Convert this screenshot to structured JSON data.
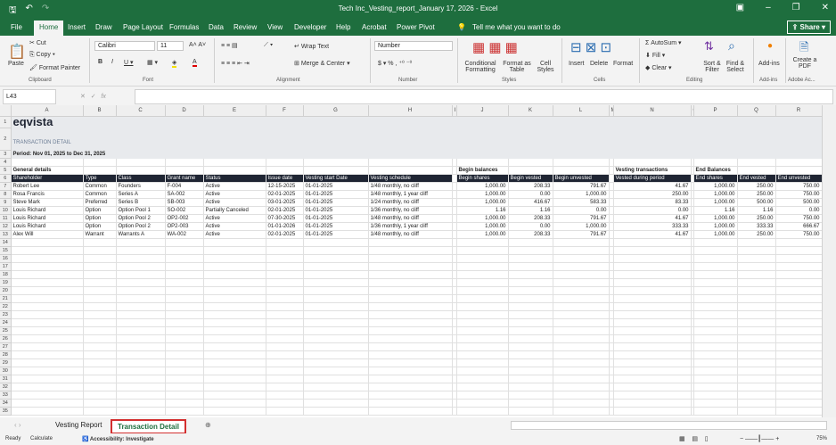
{
  "window": {
    "title": "Tech Inc_Vesting_report_January 17, 2026  -  Excel"
  },
  "ribbon_tabs": [
    "File",
    "Home",
    "Insert",
    "Draw",
    "Page Layout",
    "Formulas",
    "Data",
    "Review",
    "View",
    "Developer",
    "Help",
    "Acrobat",
    "Power Pivot"
  ],
  "tell_me": "Tell me what you want to do",
  "share": "Share",
  "clipboard": {
    "paste": "Paste",
    "cut": "Cut",
    "copy": "Copy",
    "format_painter": "Format Painter",
    "group": "Clipboard"
  },
  "font": {
    "name": "Calibri",
    "size": "11",
    "group": "Font"
  },
  "alignment": {
    "wrap": "Wrap Text",
    "merge": "Merge & Center",
    "group": "Alignment"
  },
  "number": {
    "format": "Number",
    "group": "Number"
  },
  "styles": {
    "conditional": "Conditional Formatting",
    "table": "Format as Table",
    "cell": "Cell Styles",
    "group": "Styles"
  },
  "cells": {
    "insert": "Insert",
    "delete": "Delete",
    "format": "Format",
    "group": "Cells"
  },
  "editing": {
    "autosum": "AutoSum",
    "fill": "Fill",
    "clear": "Clear",
    "sort": "Sort & Filter",
    "find": "Find & Select",
    "group": "Editing"
  },
  "addins": {
    "label": "Add-ins",
    "group": "Add-ins"
  },
  "adobe": {
    "label": "Create a PDF",
    "group": "Adobe Ac..."
  },
  "formula_bar": {
    "name_box": "L43",
    "fx": "fx",
    "value": ""
  },
  "columns": [
    "A",
    "B",
    "C",
    "D",
    "E",
    "F",
    "G",
    "H",
    "I",
    "J",
    "K",
    "L",
    "M",
    "N",
    "O",
    "P",
    "Q",
    "R"
  ],
  "sheet": {
    "logo": "eqvista",
    "subtitle": "TRANSACTION DETAIL",
    "period": "Period: Nov 01, 2025 to Dec 31, 2025",
    "sections": {
      "general": "General details",
      "begin": "Begin balances",
      "vesting": "Vesting transactions",
      "end": "End Balances"
    },
    "headers": [
      "Shareholder",
      "Type",
      "Class",
      "Grant name",
      "Status",
      "Issue date",
      "Vesting start Date",
      "Vesting schedule",
      "Begin shares",
      "Begin vested",
      "Begin unvested",
      "Vested during period",
      "End shares",
      "End vested",
      "End unvested"
    ],
    "rows": [
      [
        "Robert Lee",
        "Common",
        "Founders",
        "F-004",
        "Active",
        "12-15-2025",
        "01-01-2025",
        "1/48 monthly, no cliff",
        "1,000.00",
        "208.33",
        "791.67",
        "41.67",
        "1,000.00",
        "250.00",
        "750.00"
      ],
      [
        "Rosa Francis",
        "Common",
        "Series A",
        "SA-002",
        "Active",
        "02-01-2025",
        "01-01-2025",
        "1/48 monthly, 1 year cliff",
        "1,000.00",
        "0.00",
        "1,000.00",
        "250.00",
        "1,000.00",
        "250.00",
        "750.00"
      ],
      [
        "Steve Mark",
        "Preferred",
        "Series B",
        "SB-003",
        "Active",
        "03-01-2025",
        "01-01-2025",
        "1/24 monthly, no cliff",
        "1,000.00",
        "416.67",
        "583.33",
        "83.33",
        "1,000.00",
        "500.00",
        "500.00"
      ],
      [
        "Louis Richard",
        "Option",
        "Option Pool 1",
        "SO-002",
        "Partially Canceled",
        "02-01-2025",
        "01-01-2025",
        "1/36 monthly, no cliff",
        "1.16",
        "1.16",
        "0.00",
        "0.00",
        "1.16",
        "1.16",
        "0.00"
      ],
      [
        "Louis Richard",
        "Option",
        "Option Pool 2",
        "OP2-002",
        "Active",
        "07-30-2025",
        "01-01-2025",
        "1/48 monthly, no cliff",
        "1,000.00",
        "208.33",
        "791.67",
        "41.67",
        "1,000.00",
        "250.00",
        "750.00"
      ],
      [
        "Louis Richard",
        "Option",
        "Option Pool 2",
        "OP2-003",
        "Active",
        "01-01-2026",
        "01-01-2025",
        "1/36 monthly, 1 year cliff",
        "1,000.00",
        "0.00",
        "1,000.00",
        "333.33",
        "1,000.00",
        "333.33",
        "666.67"
      ],
      [
        "Alex Will",
        "Warrant",
        "Warrants A",
        "WA-002",
        "Active",
        "02-01-2025",
        "01-01-2025",
        "1/48 monthly, no cliff",
        "1,000.00",
        "208.33",
        "791.67",
        "41.67",
        "1,000.00",
        "250.00",
        "750.00"
      ]
    ]
  },
  "sheet_tabs": [
    "Vesting Report",
    "Transaction Detail"
  ],
  "status": {
    "ready": "Ready",
    "calculate": "Calculate",
    "accessibility": "Accessibility: Investigate",
    "zoom": "75%"
  },
  "colors": {
    "excel_green": "#1e6e3e",
    "header_fill": "#1f2533",
    "band_fill": "#e8eaed",
    "active_tab_border": "#d32f2f"
  }
}
